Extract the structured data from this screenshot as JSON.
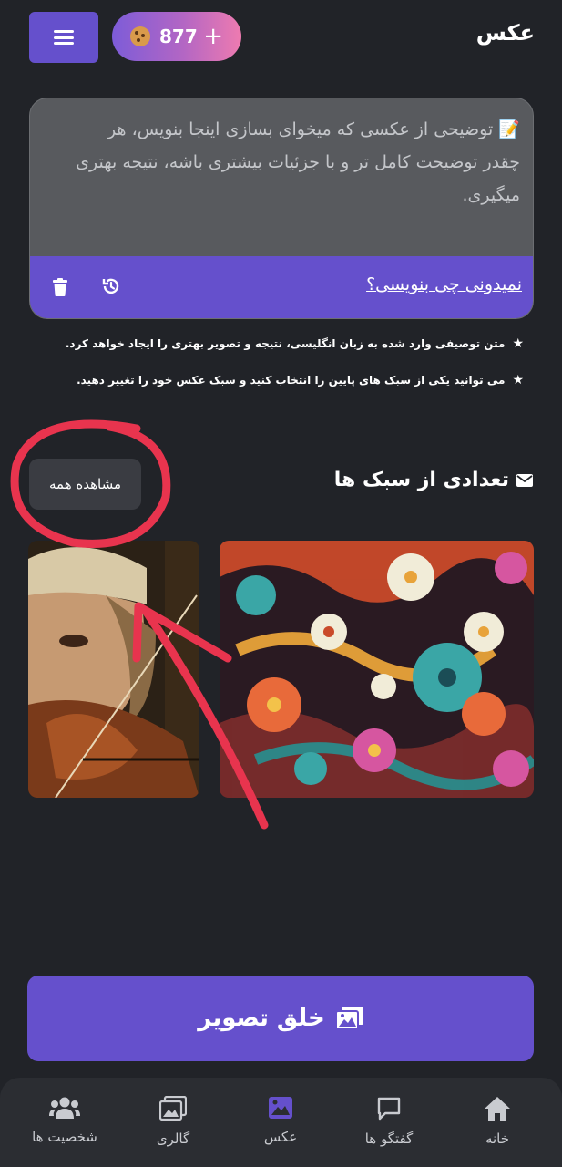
{
  "header": {
    "title": "عکس",
    "credits": "877",
    "plus": "+"
  },
  "prompt": {
    "placeholder": "📝 توضیحی از عکسی که میخوای بسازی اینجا بنویس، هر چقدر توضیحت کامل تر و با جزئیات بیشتری باشه، نتیجه بهتری میگیری.",
    "help_link": "نمیدونی چی بنویسی؟"
  },
  "notes": [
    "متن توصیفی وارد شده به زبان انگلیسی، نتیجه و تصویر بهتری را ایجاد خواهد کرد.",
    "می توانید یکی از سبک های پایین را انتخاب کنید و سبک عکس خود را تغییر دهید."
  ],
  "styles": {
    "title": "تعدادی از سبک ها",
    "see_all": "مشاهده همه"
  },
  "create_button": "خلق تصویر",
  "nav": [
    {
      "label": "خانه",
      "icon": "home-icon"
    },
    {
      "label": "گفتگو ها",
      "icon": "chat-icon"
    },
    {
      "label": "عکس",
      "icon": "image-icon",
      "active": true
    },
    {
      "label": "گالری",
      "icon": "gallery-icon"
    },
    {
      "label": "شخصیت ها",
      "icon": "users-icon"
    }
  ],
  "colors": {
    "background": "#212328",
    "accent": "#6550cc",
    "annotation": "#e8344e"
  }
}
